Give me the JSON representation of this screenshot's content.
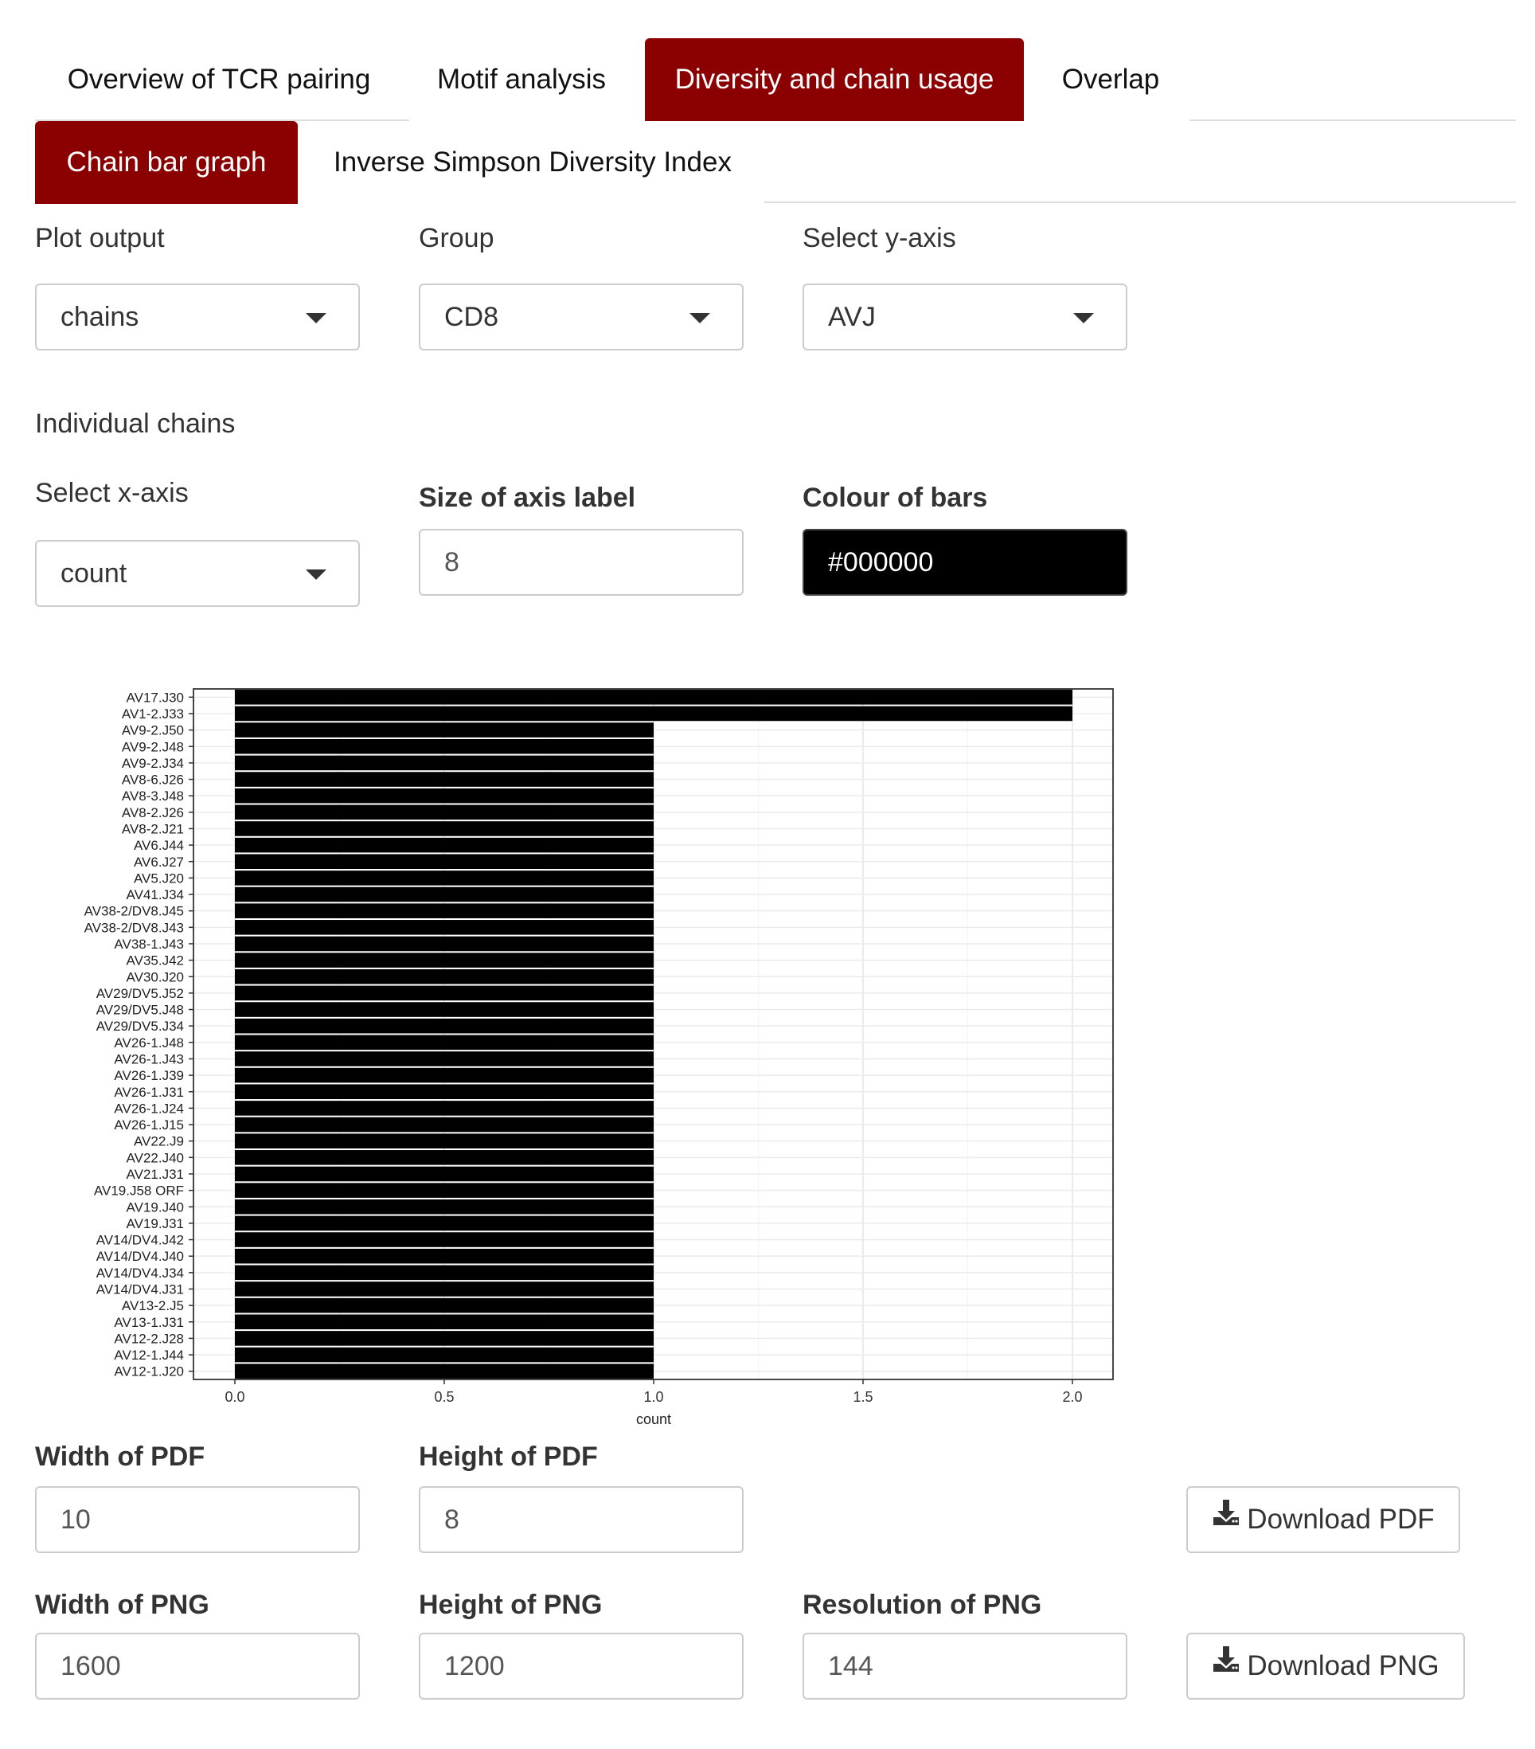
{
  "tabs": [
    {
      "label": "Overview of TCR pairing",
      "active": false
    },
    {
      "label": "Motif analysis",
      "active": false
    },
    {
      "label": "Diversity and chain usage",
      "active": true
    },
    {
      "label": "Overlap",
      "active": false
    }
  ],
  "subtabs": [
    {
      "label": "Chain bar graph",
      "active": true
    },
    {
      "label": "Inverse Simpson Diversity Index",
      "active": false
    }
  ],
  "form": {
    "plot_output_label": "Plot output",
    "plot_output_value": "chains",
    "group_label": "Group",
    "group_value": "CD8",
    "y_axis_label": "Select y-axis",
    "y_axis_value": "AVJ",
    "section_heading": "Individual chains",
    "x_axis_label": "Select x-axis",
    "x_axis_value": "count",
    "axis_label_size_label": "Size of axis label",
    "axis_label_size_value": "8",
    "bar_colour_label": "Colour of bars",
    "bar_colour_value": "#000000"
  },
  "downloads": {
    "pdf_width_label": "Width of PDF",
    "pdf_width_value": "10",
    "pdf_height_label": "Height of PDF",
    "pdf_height_value": "8",
    "pdf_button": "Download PDF",
    "png_width_label": "Width of PNG",
    "png_width_value": "1600",
    "png_height_label": "Height of PNG",
    "png_height_value": "1200",
    "png_res_label": "Resolution of PNG",
    "png_res_value": "144",
    "png_button": "Download PNG"
  },
  "icons": {
    "dropdown": "caret-down-icon",
    "download": "download-icon"
  },
  "colors": {
    "accent": "#8b0000",
    "bar": "#000000",
    "grid": "#ebebeb"
  },
  "chart_data": {
    "type": "bar",
    "orientation": "horizontal",
    "xlabel": "count",
    "ylabel": "",
    "xlim": [
      0,
      2.1
    ],
    "x_ticks": [
      "0.0",
      "0.5",
      "1.0",
      "1.5",
      "2.0"
    ],
    "grid": true,
    "categories": [
      "AV17.J30",
      "AV1-2.J33",
      "AV9-2.J50",
      "AV9-2.J48",
      "AV9-2.J34",
      "AV8-6.J26",
      "AV8-3.J48",
      "AV8-2.J26",
      "AV8-2.J21",
      "AV6.J44",
      "AV6.J27",
      "AV5.J20",
      "AV41.J34",
      "AV38-2/DV8.J45",
      "AV38-2/DV8.J43",
      "AV38-1.J43",
      "AV35.J42",
      "AV30.J20",
      "AV29/DV5.J52",
      "AV29/DV5.J48",
      "AV29/DV5.J34",
      "AV26-1.J48",
      "AV26-1.J43",
      "AV26-1.J39",
      "AV26-1.J31",
      "AV26-1.J24",
      "AV26-1.J15",
      "AV22.J9",
      "AV22.J40",
      "AV21.J31",
      "AV19.J58 ORF",
      "AV19.J40",
      "AV19.J31",
      "AV14/DV4.J42",
      "AV14/DV4.J40",
      "AV14/DV4.J34",
      "AV14/DV4.J31",
      "AV13-2.J5",
      "AV13-1.J31",
      "AV12-2.J28",
      "AV12-1.J44",
      "AV12-1.J20"
    ],
    "values": [
      2,
      2,
      1,
      1,
      1,
      1,
      1,
      1,
      1,
      1,
      1,
      1,
      1,
      1,
      1,
      1,
      1,
      1,
      1,
      1,
      1,
      1,
      1,
      1,
      1,
      1,
      1,
      1,
      1,
      1,
      1,
      1,
      1,
      1,
      1,
      1,
      1,
      1,
      1,
      1,
      1,
      1
    ]
  }
}
